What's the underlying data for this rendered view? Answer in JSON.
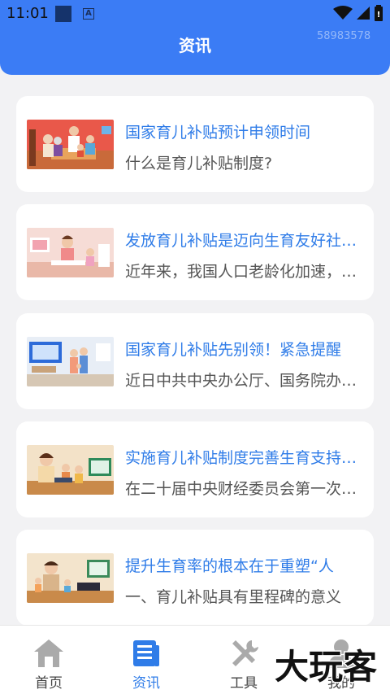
{
  "status_bar": {
    "time": "11:01",
    "a_badge": "A"
  },
  "header": {
    "title": "资讯",
    "watermark_id": "58983578"
  },
  "colors": {
    "primary": "#3b7cf5",
    "title_blue": "#2f7ce8",
    "subtitle_gray": "#555555",
    "page_bg": "#f2f2f4"
  },
  "articles": [
    {
      "title": "国家育儿补贴预计申领时间",
      "subtitle": "什么是育儿补贴制度?",
      "thumb": "family-illustration"
    },
    {
      "title": "发放育儿补贴是迈向生育友好社会的重要一步",
      "subtitle": "近年来，我国人口老龄化加速，生育率持续走低",
      "thumb": "mother-child-desk-illustration"
    },
    {
      "title": "国家育儿补贴先别领！紧急提醒",
      "subtitle": "近日中共中央办公厅、国务院办公厅印发",
      "thumb": "family-living-room-illustration"
    },
    {
      "title": "实施育儿补贴制度完善生育支持政策",
      "subtitle": "在二十届中央财经委员会第一次会议上",
      "thumb": "mother-children-tablet-illustration"
    },
    {
      "title": "提升生育率的根本在于重塑“人",
      "subtitle": "一、育儿补贴具有里程碑的意义",
      "thumb": "father-children-tablet-illustration"
    }
  ],
  "tabbar": {
    "items": [
      {
        "label": "首页",
        "icon": "home-icon",
        "active": false
      },
      {
        "label": "资讯",
        "icon": "news-icon",
        "active": true
      },
      {
        "label": "工具",
        "icon": "tools-icon",
        "active": false
      },
      {
        "label": "我的",
        "icon": "user-icon",
        "active": false
      }
    ]
  },
  "watermark_brand": "大玩客"
}
